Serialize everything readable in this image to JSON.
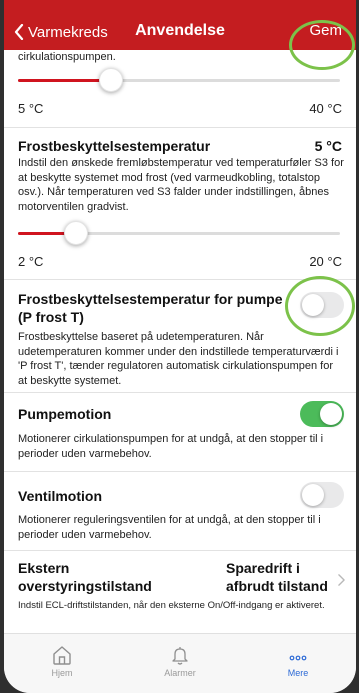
{
  "navbar": {
    "back_label": "Varmekreds",
    "title": "Anvendelse",
    "save_label": "Gem"
  },
  "top_section": {
    "partial_text": "cirkulationspumpen.",
    "slider_min": "5 °C",
    "slider_max": "40 °C",
    "slider_level": 0.29
  },
  "frost_temp": {
    "title": "Frostbeskyttelsestemperatur",
    "value": "5 °C",
    "description": "Indstil den ønskede fremløbstemperatur ved temperaturføler S3 for at beskytte systemet mod frost (ved varmeudkobling, totalstop osv.). Når temperaturen ved S3 falder under indstillingen, åbnes motorventilen gradvist.",
    "slider_min": "2 °C",
    "slider_max": "20 °C",
    "slider_level": 0.18
  },
  "frost_pump": {
    "title": "Frostbeskyttelsestemperatur for pumpe (P frost T)",
    "description": "Frostbeskyttelse baseret på udetemperaturen. Når udetemperaturen kommer under den indstillede temperaturværdi i 'P frost T', tænder regulatoren automatisk cirkulationspumpen for at beskytte systemet.",
    "enabled": false
  },
  "pump_motion": {
    "title": "Pumpemotion",
    "description": "Motionerer cirkulationspumpen for at undgå, at den stopper til i perioder uden varmebehov.",
    "enabled": true
  },
  "valve_motion": {
    "title": "Ventilmotion",
    "description": "Motionerer reguleringsventilen for at undgå, at den stopper til i perioder uden varmebehov.",
    "enabled": false
  },
  "external": {
    "title_line1": "Ekstern",
    "title_line2": "overstyringstilstand",
    "value_line1": "Sparedrift i",
    "value_line2": "afbrudt tilstand",
    "description": "Indstil ECL-driftstilstanden, når den eksterne On/Off-indgang er aktiveret."
  },
  "tabbar": {
    "tabs": [
      {
        "label": "Hjem",
        "icon": "home-icon"
      },
      {
        "label": "Alarmer",
        "icon": "bell-icon"
      },
      {
        "label": "Mere",
        "icon": "more-icon"
      }
    ]
  },
  "colors": {
    "navbar": "#c41d20",
    "toggle_on": "#4cbb5a",
    "highlight": "#7cc24a",
    "tab_active": "#2e6bd6"
  }
}
